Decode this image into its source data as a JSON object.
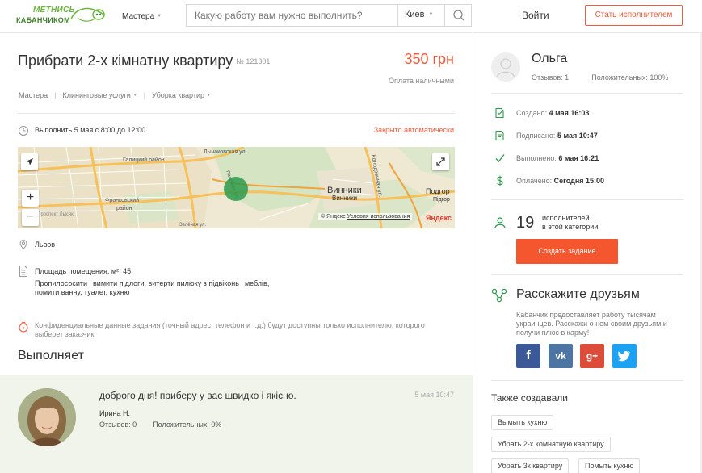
{
  "header": {
    "logo_line1": "МЕТНИСЬ",
    "logo_line2": "КАБАНЧИКОМ",
    "masters_label": "Мастера",
    "search_placeholder": "Какую работу вам нужно выполнить?",
    "city": "Киев",
    "login_label": "Войти",
    "become_label": "Стать исполнителем"
  },
  "task": {
    "title": "Прибрати 2-х кімнатну квартиру",
    "number": "№ 121301",
    "price": "350 грн",
    "payment": "Оплата наличными",
    "breadcrumbs": [
      "Мастера",
      "Клининговые услуги",
      "Уборка квартир"
    ],
    "when": "Выполнить 5 мая с 8:00 до 12:00",
    "auto_closed": "Закрыто автоматически",
    "location": "Львов",
    "area": "Площадь помещения, м²: 45",
    "description_line1": "Пропилососити і вимити підлоги, витерти пилюку з підвіконь і меблів,",
    "description_line2": "помити ванну, туалет, кухню",
    "confidential_line1": "Конфиденциальные данные задания (точный адрес, телефон и т.д.) будут доступны только исполнителю, которого",
    "confidential_line2": "выберет заказчик",
    "executes_title": "Выполняет"
  },
  "map": {
    "labels": {
      "galytskyi": "Галицкий район",
      "frankivskyi": "Франковский",
      "frankivskyi2": "район",
      "prospect": "Проспект Лысяк",
      "street1": "Лычаковская ул.",
      "street2": "Пасечная ул.",
      "street3": "Зелёная ул.",
      "vynnyky": "Винники",
      "vynnyky_ua": "Винники",
      "podgortsy": "Подгор",
      "podgortsy2": "Підгор",
      "kolodz": "Колодзенная ул.",
      "copyright": "© Яндекс",
      "terms": "Условия использования",
      "brand": "Яндекс"
    }
  },
  "executor": {
    "message": "доброго дня! приберу у вас швидко і якісно.",
    "date": "5 мая 10:47",
    "name": "Ирина Н.",
    "reviews": "Отзывов: 0",
    "positive": "Положительных: 0%"
  },
  "client": {
    "name": "Ольга",
    "reviews": "Отзывов: 1",
    "positive": "Положительных: 100%"
  },
  "statuses": [
    {
      "label": "Создано:",
      "value": "4 мая 16:03"
    },
    {
      "label": "Подписано:",
      "value": "5 мая 10:47"
    },
    {
      "label": "Выполнено:",
      "value": "6 мая 16:21"
    },
    {
      "label": "Оплачено:",
      "value": "Сегодня 15:00"
    }
  ],
  "performers": {
    "count": "19",
    "line1": "исполнителей",
    "line2": "в этой категории",
    "create_label": "Создать задание"
  },
  "share": {
    "title": "Расскажите друзьям",
    "text": "Кабанчик предоставляет работу тысячам украинцев. Расскажи о нем своим друзьям и получи плюс в карму!",
    "networks": [
      "f",
      "vk",
      "g+",
      "twitter"
    ]
  },
  "also": {
    "title": "Также создавали",
    "tags": [
      "Вымыть кухню",
      "Убрать 2-х комнатную квартиру",
      "Убрать 3к квартиру",
      "Помыть кухню"
    ]
  },
  "colors": {
    "accent": "#ef5a3c",
    "button": "#f4572d",
    "green": "#2e9a4b",
    "facebook": "#3b5998",
    "vk": "#4c75a3",
    "gplus": "#dd4b39",
    "twitter": "#1da1f2"
  }
}
